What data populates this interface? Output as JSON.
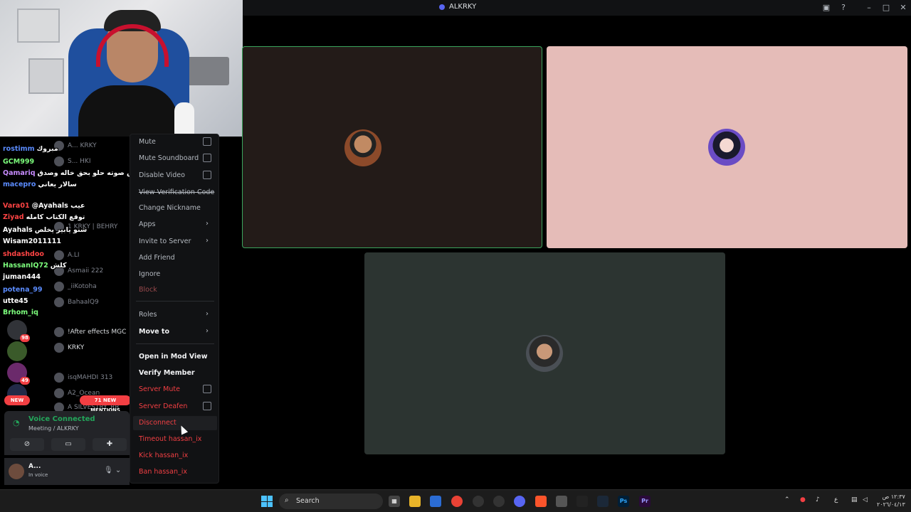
{
  "window": {
    "title": "ALKRKY"
  },
  "chat": [
    {
      "user": "rostimm",
      "msg": "مبروك",
      "color": "#5b8cff"
    },
    {
      "user": "GCM999",
      "msg": "",
      "color": "#7dff7d"
    },
    {
      "user": "Qamariq",
      "msg": "احس صوته حلو بحق خاله وصدق",
      "color": "#c88cff"
    },
    {
      "user": "macepro",
      "msg": "سالار يعاني",
      "color": "#5b8cff"
    },
    {
      "user": "Vara01",
      "msg": "@Ayahals عيب",
      "color": "#ff4444"
    },
    {
      "user": "Ziyad",
      "msg": "توقع الكتاب كامله",
      "color": "#ff4444"
    },
    {
      "user": "Ayahals",
      "msg": "شنو يابير يخلص",
      "color": "#ffffff"
    },
    {
      "user": "Wisam2011111",
      "msg": "",
      "color": "#ffffff"
    },
    {
      "user": "shdashdoo",
      "msg": "",
      "color": "#ff4444"
    },
    {
      "user": "HassanIQ72",
      "msg": "كلش",
      "color": "#7dff7d"
    },
    {
      "user": "juman444",
      "msg": "",
      "color": "#ffffff"
    },
    {
      "user": "potena_99",
      "msg": "",
      "color": "#5b8cff"
    },
    {
      "user": "utte45",
      "msg": "",
      "color": "#ffffff"
    },
    {
      "user": "Brhom_iq",
      "msg": "",
      "color": "#7dff7d"
    }
  ],
  "members": [
    {
      "name": "A... KRKY"
    },
    {
      "name": "S... HKI"
    },
    {
      "name": "1 KRKY | BEHRY"
    },
    {
      "name": "A.LI"
    },
    {
      "name": "Asmaii 222"
    },
    {
      "name": "_iiKotoha"
    },
    {
      "name": "BahaalQ9"
    },
    {
      "name": "!After effects MGC"
    },
    {
      "name": "KRKY"
    },
    {
      "name": "isqMAHDI 313"
    },
    {
      "name": "A2_Ocean"
    },
    {
      "name": "A SILVESTRY_RR"
    }
  ],
  "servers": [
    {
      "badge": "98"
    },
    {
      "badge": ""
    },
    {
      "badge": "49"
    },
    {
      "badge": ""
    }
  ],
  "pills": {
    "new": "NEW",
    "mentions": "71 NEW MENTIONS"
  },
  "voice": {
    "status": "Voice Connected",
    "channel": "Meeting / ALKRKY",
    "user": "A...",
    "user_status": "In voice"
  },
  "menu": {
    "mute": "Mute",
    "mute_soundboard": "Mute Soundboard",
    "disable_video": "Disable Video",
    "view_verification": "View Verification Code",
    "change_nickname": "Change Nickname",
    "apps": "Apps",
    "invite": "Invite to Server",
    "add_friend": "Add Friend",
    "ignore": "Ignore",
    "block": "Block",
    "roles": "Roles",
    "move_to": "Move to",
    "mod_view": "Open in Mod View",
    "verify": "Verify Member",
    "server_mute": "Server Mute",
    "server_deafen": "Server Deafen",
    "disconnect": "Disconnect",
    "timeout": "Timeout hassan_ix",
    "kick": "Kick hassan_ix",
    "ban": "Ban hassan_ix"
  },
  "taskbar": {
    "search": "Search",
    "lang": "ع",
    "time": "١٢:٣٧ ص",
    "date": "٢٠٢٦/٠٤/١٣"
  }
}
